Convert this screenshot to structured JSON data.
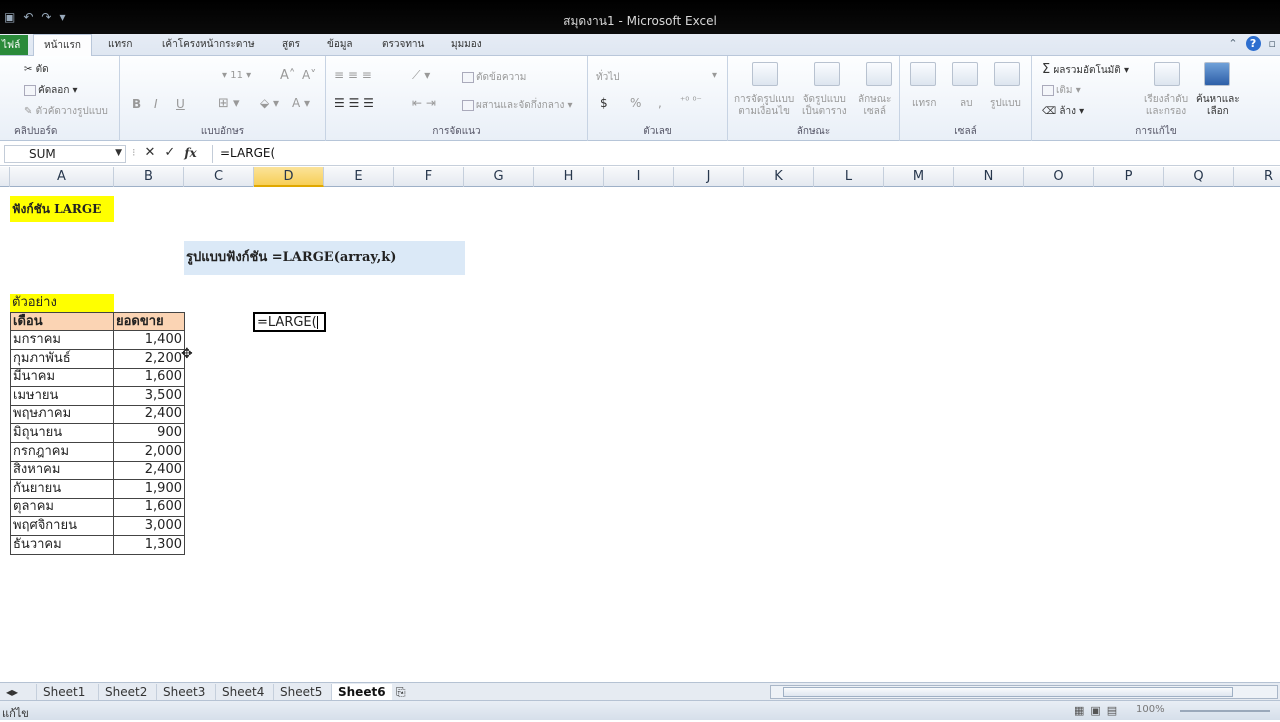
{
  "window": {
    "title": "สมุดงาน1  -  Microsoft Excel"
  },
  "ribbon_tabs": [
    "ไฟล์",
    "หน้าแรก",
    "แทรก",
    "เค้าโครงหน้ากระดาษ",
    "สูตร",
    "ข้อมูล",
    "ตรวจทาน",
    "มุมมอง"
  ],
  "ribbon": {
    "clipboard": {
      "cut": "ตัด",
      "copy": "คัดลอก",
      "format_painter": "ตัวคัดวางรูปแบบ",
      "label": "คลิปบอร์ด"
    },
    "font": {
      "size": "11",
      "bold": "B",
      "italic": "I",
      "underline": "U",
      "label": "แบบอักษร"
    },
    "alignment": {
      "wrap": "ตัดข้อความ",
      "merge": "ผสานและจัดกึ่งกลาง",
      "label": "การจัดแนว"
    },
    "number": {
      "format": "ทั่วไป",
      "currency": "$",
      "percent": "%",
      "comma": ",",
      "label": "ตัวเลข"
    },
    "styles": {
      "conditional": "การจัดรูปแบบ\nตามเงื่อนไข",
      "as_table": "จัดรูปแบบ\nเป็นตาราง",
      "cell_styles": "ลักษณะ\nเซลล์",
      "label": "ลักษณะ"
    },
    "cells": {
      "insert": "แทรก",
      "delete": "ลบ",
      "format": "รูปแบบ",
      "label": "เซลล์"
    },
    "editing": {
      "autosum": "ผลรวมอัตโนมัติ",
      "fill": "เติม",
      "clear": "ล้าง",
      "sort": "เรียงลำดับ\nและกรอง",
      "find": "ค้นหาและ\nเลือก",
      "label": "การแก้ไข"
    }
  },
  "formula_bar": {
    "name_box": "SUM",
    "cancel": "✕",
    "enter": "✓",
    "fx": "fx",
    "formula": "=LARGE("
  },
  "columns": [
    "A",
    "B",
    "C",
    "D",
    "E",
    "F",
    "G",
    "H",
    "I",
    "J",
    "K",
    "L",
    "M",
    "N",
    "O",
    "P",
    "Q",
    "R"
  ],
  "selected_column": "D",
  "cells": {
    "title": "ฟังก์ชัน LARGE",
    "syntax": "รูปแบบฟังก์ชัน =LARGE(array,k)",
    "example_label": "ตัวอย่าง",
    "header_month": "เดือน",
    "header_sales": "ยอดขาย",
    "active_cell": "=LARGE("
  },
  "table_rows": [
    {
      "month": "มกราคม",
      "sales": "1,400"
    },
    {
      "month": "กุมภาพันธ์",
      "sales": "2,200"
    },
    {
      "month": "มีนาคม",
      "sales": "1,600"
    },
    {
      "month": "เมษายน",
      "sales": "3,500"
    },
    {
      "month": "พฤษภาคม",
      "sales": "2,400"
    },
    {
      "month": "มิถุนายน",
      "sales": "900"
    },
    {
      "month": "กรกฎาคม",
      "sales": "2,000"
    },
    {
      "month": "สิงหาคม",
      "sales": "2,400"
    },
    {
      "month": "กันยายน",
      "sales": "1,900"
    },
    {
      "month": "ตุลาคม",
      "sales": "1,600"
    },
    {
      "month": "พฤศจิกายน",
      "sales": "3,000"
    },
    {
      "month": "ธันวาคม",
      "sales": "1,300"
    }
  ],
  "sheet_tabs": [
    "Sheet1",
    "Sheet2",
    "Sheet3",
    "Sheet4",
    "Sheet5",
    "Sheet6"
  ],
  "active_sheet": "Sheet6",
  "status": {
    "mode": "แก้ไข",
    "zoom": "100%"
  }
}
